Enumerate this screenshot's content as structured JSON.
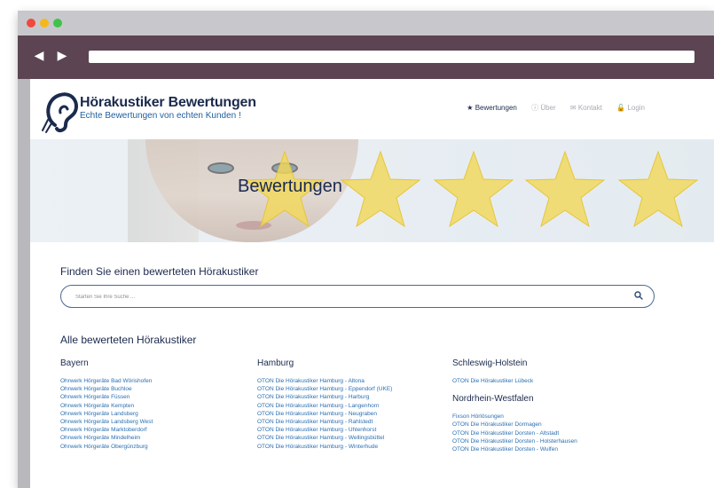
{
  "site": {
    "brand_title": "Hörakustiker Bewertungen",
    "brand_subtitle": "Echte Bewertungen von echten Kunden !"
  },
  "nav": {
    "items": [
      {
        "label": "Bewertungen",
        "icon": "star-icon",
        "active": true
      },
      {
        "label": "Über",
        "icon": "info-icon",
        "active": false
      },
      {
        "label": "Kontakt",
        "icon": "mail-icon",
        "active": false
      },
      {
        "label": "Login",
        "icon": "lock-icon",
        "active": false
      }
    ]
  },
  "hero": {
    "title": "Bewertungen"
  },
  "search": {
    "heading": "Finden Sie einen bewerteten Hörakustiker",
    "placeholder": "Starten Sie Ihre Suche ..."
  },
  "listing": {
    "heading": "Alle bewerteten Hörakustiker",
    "columns": [
      {
        "regions": [
          {
            "name": "Bayern",
            "links": [
              "Ohrwerk Hörgeräte Bad Wörishofen",
              "Ohrwerk Hörgeräte Buchloe",
              "Ohrwerk Hörgeräte Füssen",
              "Ohrwerk Hörgeräte Kempten",
              "Ohrwerk Hörgeräte Landsberg",
              "Ohrwerk Hörgeräte Landsberg West",
              "Ohrwerk Hörgeräte Marktoberdorf",
              "Ohrwerk Hörgeräte Mindelheim",
              "Ohrwerk Hörgeräte Obergünzburg"
            ]
          }
        ]
      },
      {
        "regions": [
          {
            "name": "Hamburg",
            "links": [
              "OTON Die Hörakustiker Hamburg - Altona",
              "OTON Die Hörakustiker Hamburg - Eppendorf (UKE)",
              "OTON Die Hörakustiker Hamburg - Harburg",
              "OTON Die Hörakustiker Hamburg - Langenhorn",
              "OTON Die Hörakustiker Hamburg - Neugraben",
              "OTON Die Hörakustiker Hamburg - Rahlstedt",
              "OTON Die Hörakustiker Hamburg - Uhlenhorst",
              "OTON Die Hörakustiker Hamburg - Wellingsbüttel",
              "OTON Die Hörakustiker Hamburg - Winterhude"
            ]
          }
        ]
      },
      {
        "regions": [
          {
            "name": "Schleswig-Holstein",
            "links": [
              "OTON Die Hörakustiker Lübeck"
            ]
          },
          {
            "name": "Nordrhein-Westfalen",
            "links": [
              "Fixson Hörlösungen",
              "OTON Die Hörakustiker Dormagen",
              "OTON Die Hörakustiker Dorsten - Altstadt",
              "OTON Die Hörakustiker Dorsten - Holsterhausen",
              "OTON Die Hörakustiker Dorsten - Wulfen"
            ]
          }
        ]
      }
    ]
  },
  "colors": {
    "navy": "#1b2a4d",
    "link": "#2b6fb1",
    "star": "#f2d85a",
    "browser_bar": "#5c4452"
  }
}
